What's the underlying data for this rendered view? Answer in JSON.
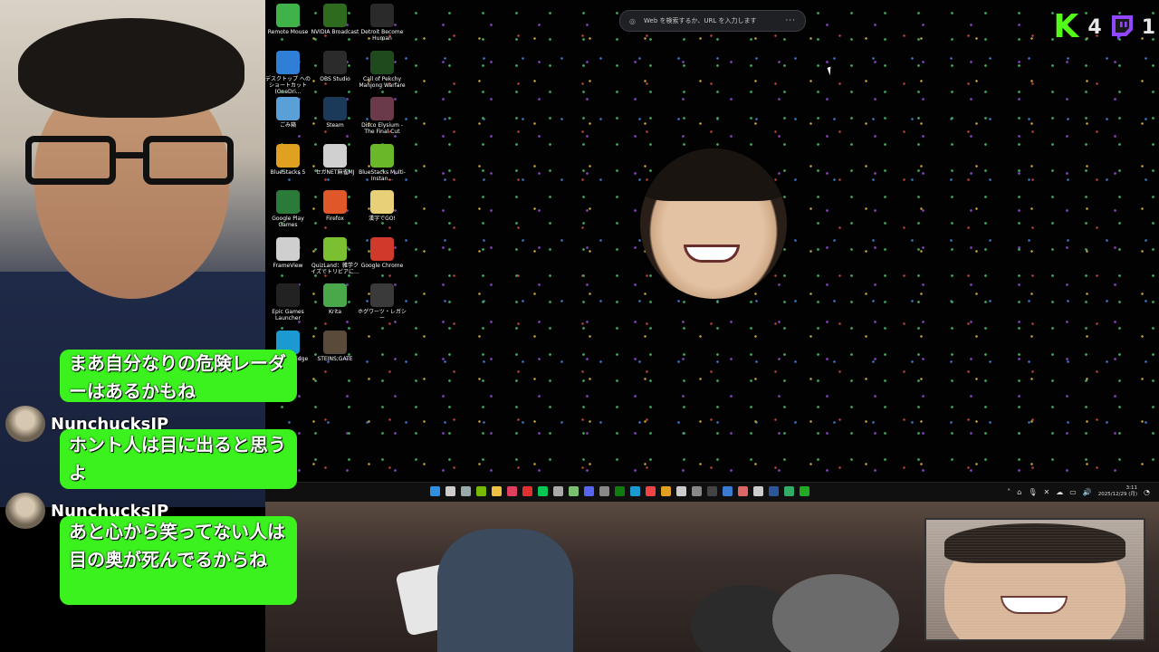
{
  "desktop_icons": [
    {
      "label": "Remote Mouse",
      "icon": "remote-mouse-icon",
      "color": "#3fb24a"
    },
    {
      "label": "NVIDIA Broadcast",
      "icon": "nvidia-icon",
      "color": "#2f6b1e"
    },
    {
      "label": "Detroit Become Human",
      "icon": "detroit-icon",
      "color": "#2a2a2a"
    },
    {
      "label": "デスクトップ へのショートカット (OneDri...",
      "icon": "onedrive-icon",
      "color": "#2f7fd6"
    },
    {
      "label": "OBS Studio",
      "icon": "obs-icon",
      "color": "#2b2b2b"
    },
    {
      "label": "Call of Pekchy Mahjong Warfare",
      "icon": "mahjong-icon",
      "color": "#1e4a1e"
    },
    {
      "label": "ごみ箱",
      "icon": "recycle-bin-icon",
      "color": "#5aa0d8"
    },
    {
      "label": "Steam",
      "icon": "steam-icon",
      "color": "#1b3a5a"
    },
    {
      "label": "Disco Elysium - The Final Cut",
      "icon": "disco-elysium-icon",
      "color": "#6a3a4a"
    },
    {
      "label": "BlueStacks 5",
      "icon": "bluestacks-icon",
      "color": "#e0a020"
    },
    {
      "label": "セガNET麻雀MJ",
      "icon": "sega-mj-icon",
      "color": "#d0d0d0"
    },
    {
      "label": "BlueStacks Multi-Instan...",
      "icon": "bluestacks-multi-icon",
      "color": "#6ab82a"
    },
    {
      "label": "Google Play Games",
      "icon": "google-play-games-icon",
      "color": "#2a7a3a"
    },
    {
      "label": "Firefox",
      "icon": "firefox-icon",
      "color": "#e0582a"
    },
    {
      "label": "漢字でGO!",
      "icon": "kanji-go-icon",
      "color": "#e8d078"
    },
    {
      "label": "FrameView",
      "icon": "frameview-icon",
      "color": "#cfcfcf"
    },
    {
      "label": "QuizLand：雑学クイズでトリビアに...",
      "icon": "quizland-icon",
      "color": "#7ac030"
    },
    {
      "label": "Google Chrome",
      "icon": "chrome-icon",
      "color": "#d03a2a"
    },
    {
      "label": "Epic Games Launcher",
      "icon": "epic-games-icon",
      "color": "#222222"
    },
    {
      "label": "Krita",
      "icon": "krita-icon",
      "color": "#4aa84a"
    },
    {
      "label": "ホグワーツ・レガシー",
      "icon": "hogwarts-icon",
      "color": "#3a3a3a"
    },
    {
      "label": "Microsoft Edge",
      "icon": "edge-icon",
      "color": "#1a9ad0"
    },
    {
      "label": "STEINS;GATE",
      "icon": "steins-gate-icon",
      "color": "#5a4a3a"
    }
  ],
  "search": {
    "placeholder": "Web を検索するか、URL を入力します"
  },
  "overlay": {
    "kick_count": "4",
    "twitch_count": "1",
    "kick_color": "#53fc18",
    "twitch_color": "#9146ff"
  },
  "taskbar": {
    "icons": [
      "windows-start-icon",
      "search-icon",
      "task-view-icon",
      "nvidia-app-icon",
      "file-explorer-icon",
      "app-icon",
      "record-icon",
      "line-icon",
      "app-icon-2",
      "v-app-icon",
      "discord-icon",
      "app-icon-3",
      "xbox-icon",
      "edge-icon",
      "chrome-icon",
      "app-icon-4",
      "app-icon-5",
      "app-icon-6",
      "obs-icon",
      "email-icon",
      "photo-icon",
      "app-icon-7",
      "word-icon",
      "app-icon-8",
      "app-icon-9"
    ],
    "clock_time": "3:11",
    "clock_date": "2025/12/29 (月)"
  },
  "chat": {
    "messages": [
      {
        "user": "",
        "text": "まあ自分なりの危険レーダーはあるかもね"
      },
      {
        "user": "NunchucksJP",
        "text": "ホント人は目に出ると思うよ"
      },
      {
        "user": "NunchucksJP",
        "text": "あと心から笑ってない人は目の奥が死んでるからね"
      }
    ],
    "bubble_color": "#3bf21f"
  }
}
